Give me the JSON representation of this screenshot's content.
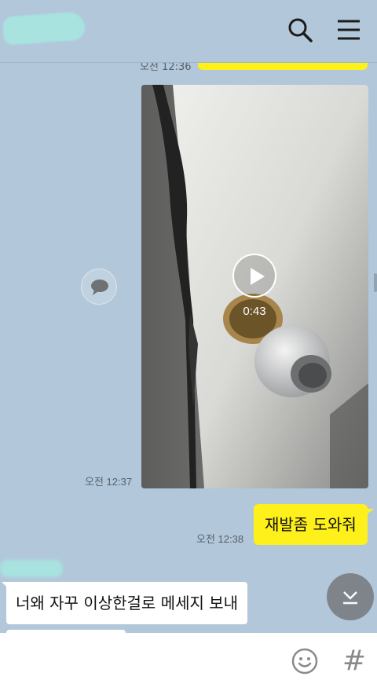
{
  "header": {
    "chat_name": "",
    "search_icon": "search-icon",
    "menu_icon": "menu-icon"
  },
  "messages": {
    "previous_time": "오전 12:36",
    "video": {
      "duration": "0:43",
      "time": "오전 12:37",
      "play_icon": "play-icon",
      "share_icon": "speech-bubble-icon"
    },
    "outgoing": {
      "text": "재발좀 도와줘",
      "time": "오전 12:38"
    },
    "incoming": {
      "text": "너왜 자꾸 이상한걸로 메세지 보내"
    }
  },
  "input_bar": {
    "placeholder": "",
    "emoji_icon": "smiley-icon",
    "hash_label": "#"
  },
  "colors": {
    "background": "#b2c7da",
    "outgoing_bubble": "#fef01b",
    "incoming_bubble": "#ffffff",
    "blurred_name": "#a8e3e0"
  }
}
